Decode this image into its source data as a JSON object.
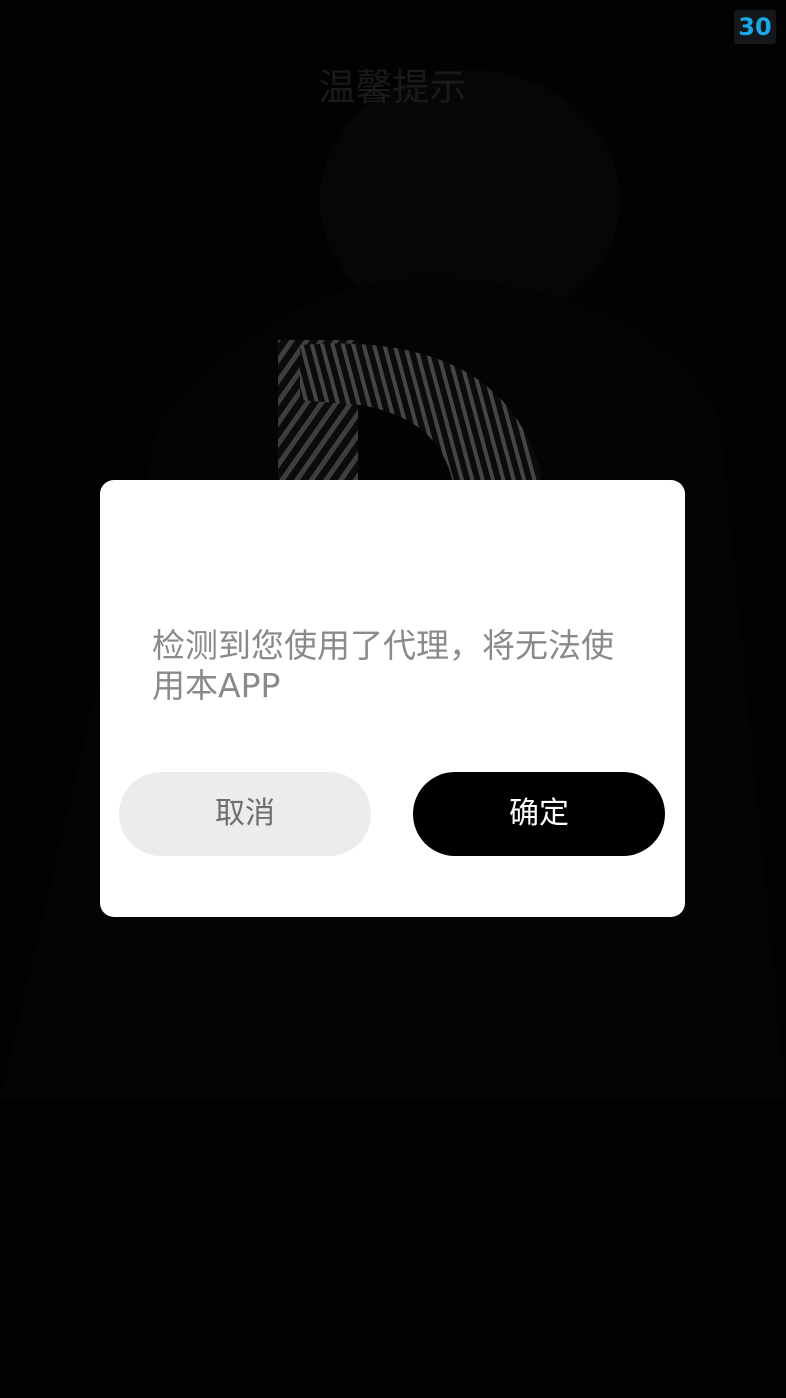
{
  "splash": {
    "countdown": "30",
    "countdown_color": "#1aa8e8"
  },
  "dialog": {
    "title": "温馨提示",
    "message": "检测到您使用了代理，将无法使用本APP",
    "cancel_label": "取消",
    "confirm_label": "确定"
  },
  "colors": {
    "overlay": "#060606",
    "dialog_bg": "#ffffff",
    "confirm_bg": "#000000",
    "cancel_bg": "#ececec"
  }
}
